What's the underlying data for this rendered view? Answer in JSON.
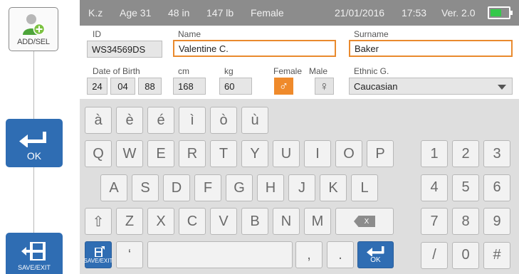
{
  "sidebar": {
    "add_label": "ADD/SEL",
    "ok_label": "OK",
    "save_label": "SAVE/EXIT"
  },
  "status_bar": {
    "user": "K.z",
    "age": "Age 31",
    "height": "48 in",
    "weight": "147 lb",
    "gender": "Female",
    "date": "21/01/2016",
    "time": "17:53",
    "version": "Ver. 2.0",
    "battery_level": 0.62,
    "battery_color": "#35c84a",
    "background": "#8c8c8c"
  },
  "form": {
    "id_label": "ID",
    "id_value": "WS34569DS",
    "name_label": "Name",
    "name_value": "Valentine C.",
    "surname_label": "Surname",
    "surname_value": "Baker",
    "dob_label": "Date of Birth",
    "dob_day": "24",
    "dob_month": "04",
    "dob_year": "88",
    "cm_label": "cm",
    "cm_value": "168",
    "kg_label": "kg",
    "kg_value": "60",
    "female_label": "Female",
    "male_label": "Male",
    "female_symbol": "♂",
    "male_symbol": "♀",
    "ethnic_label": "Ethnic G.",
    "ethnic_value": "Caucasian",
    "active_border_color": "#e98a2e"
  },
  "keyboard": {
    "accent_row": [
      "à",
      "è",
      "é",
      "ì",
      "ò",
      "ù"
    ],
    "row1": [
      "Q",
      "W",
      "E",
      "R",
      "T",
      "Y",
      "U",
      "I",
      "O",
      "P"
    ],
    "row2": [
      "A",
      "S",
      "D",
      "F",
      "G",
      "H",
      "J",
      "K",
      "L"
    ],
    "row3": [
      "Z",
      "X",
      "C",
      "V",
      "B",
      "N",
      "M"
    ],
    "numpad": [
      "1",
      "2",
      "3",
      "4",
      "5",
      "6",
      "7",
      "8",
      "9",
      "/",
      "0",
      "#"
    ],
    "apostrophe": "‘",
    "comma": ",",
    "period": ".",
    "backspace_glyph": "X",
    "shift_glyph": "⇧",
    "save_exit_label": "SAVE/EXIT",
    "ok_label": "OK",
    "key_blue": "#2f6db3"
  }
}
